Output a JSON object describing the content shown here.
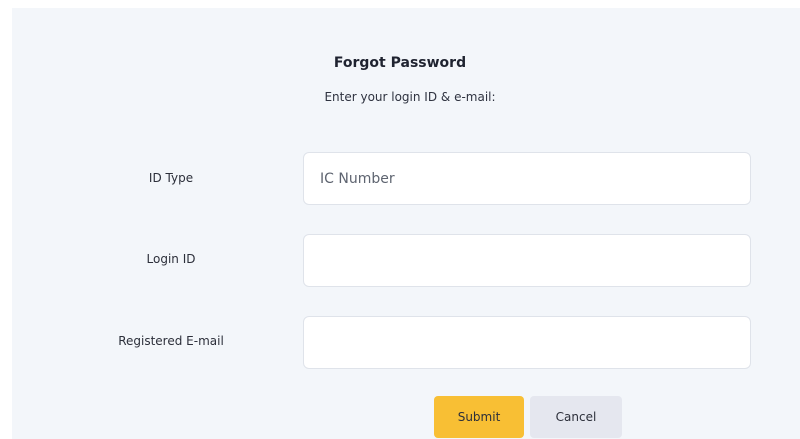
{
  "form": {
    "title": "Forgot Password",
    "subtitle": "Enter your login ID & e-mail:",
    "fields": [
      {
        "label": "ID Type",
        "value": "IC Number"
      },
      {
        "label": "Login ID",
        "value": ""
      },
      {
        "label": "Registered E-mail",
        "value": ""
      }
    ]
  },
  "buttons": {
    "submit_label": "Submit",
    "cancel_label": "Cancel"
  },
  "colors": {
    "panel_background": "#f3f6fa",
    "submit_background": "#f8bf34",
    "cancel_background": "#e5e7ef"
  }
}
